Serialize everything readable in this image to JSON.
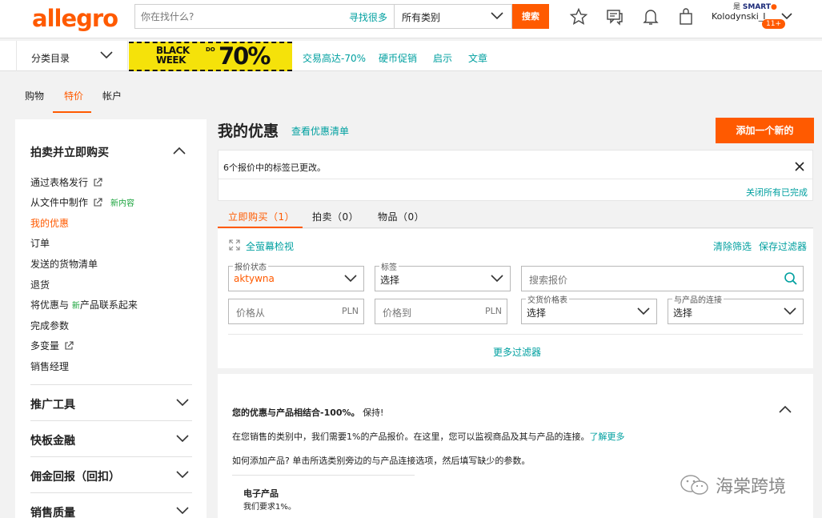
{
  "header": {
    "logo": "allegro",
    "search_placeholder": "你在找什么?",
    "search_many": "寻找很多",
    "category_select": "所有类别",
    "search_button": "搜索",
    "smart_prefix": "是",
    "smart_label": "SMART",
    "username": "Kolodynski_I",
    "badge": "11+"
  },
  "catbar": {
    "menu_label": "分类目录",
    "banner": {
      "line1": "BLACK",
      "line2": "WEEK",
      "do": "DO",
      "pct": "70%"
    },
    "links": [
      "交易高达-70%",
      "硬币促销",
      "启示",
      "文章"
    ]
  },
  "main_tabs": [
    {
      "label": "购物"
    },
    {
      "label": "特价"
    },
    {
      "label": "帐户"
    }
  ],
  "sidebar": {
    "title": "拍卖并立即购买",
    "items": [
      {
        "label": "通过表格发行"
      },
      {
        "label": "从文件中制作",
        "new": "新内容"
      },
      {
        "label": "我的优惠"
      },
      {
        "label": "订单"
      },
      {
        "label": "发送的货物清单"
      },
      {
        "label": "退货"
      },
      {
        "label_pre": "将优惠与 ",
        "label_new": "新",
        "label_post": "产品联系起来"
      },
      {
        "label": "完成参数"
      },
      {
        "label": "多变量"
      },
      {
        "label": "销售经理"
      }
    ],
    "sections": [
      "推广工具",
      "快板金融",
      "佣金回报（回扣）",
      "销售质量"
    ]
  },
  "main": {
    "title": "我的优惠",
    "view_list_link": "查看优惠清单",
    "add_button": "添加一个新的",
    "notice": {
      "message": "6个报价中的标签已更改。",
      "close_all": "关闭所有已完成"
    },
    "offer_tabs": [
      "立即购买（1）",
      "拍卖（0）",
      "物品（0）"
    ],
    "filters": {
      "fullscreen": "全萤幕检视",
      "clear": "清除筛选",
      "save": "保存过滤器",
      "status_label": "报价状态",
      "status_value": "aktywna",
      "tags_label": "标签",
      "tags_value": "选择",
      "search_placeholder": "搜索报价",
      "price_from": "价格从",
      "price_to": "价格到",
      "currency": "PLN",
      "delivery_label": "交货价格表",
      "delivery_value": "选择",
      "product_link_label": "与产品的连接",
      "product_link_value": "选择",
      "more_filters": "更多过滤器"
    },
    "info": {
      "heading_bold": "您的优惠与产品相结合-100%。",
      "heading_rest": "保持!",
      "paragraph1": "在您销售的类别中，我们需要1%的产品报价。在这里，您可以监视商品及其与产品的连接。",
      "learn_more": "了解更多",
      "paragraph2": "如何添加产品? 单击所选类别旁边的与产品连接选项，然后填写缺少的参数。",
      "category_title": "电子产品",
      "category_desc": "我们要求1%。"
    }
  },
  "watermark": "海棠跨境",
  "colors": {
    "accent": "#ff5a00",
    "link": "#00a0a0",
    "new": "#19a33b"
  }
}
